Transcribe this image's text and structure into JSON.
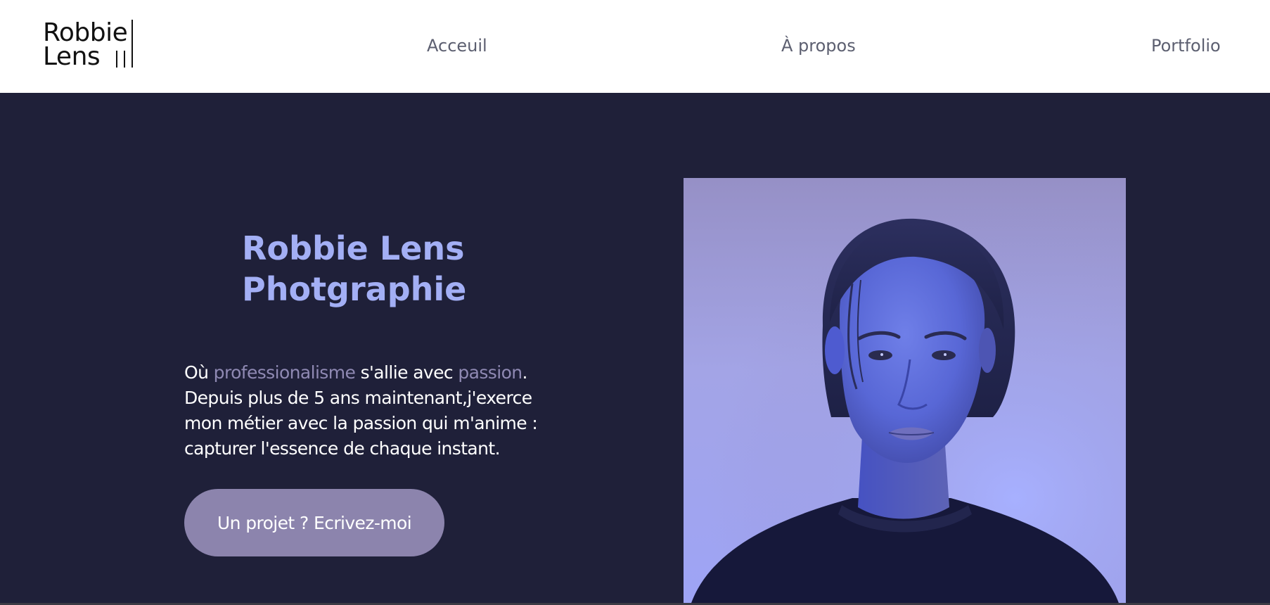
{
  "brand": {
    "logo_line1": "Robbie",
    "logo_line2": "Lens"
  },
  "nav": {
    "items": [
      {
        "label": "Acceuil"
      },
      {
        "label": "À propos"
      },
      {
        "label": "Portfolio"
      }
    ]
  },
  "hero": {
    "title_line1": "Robbie Lens",
    "title_line2": "Photgraphie",
    "desc": {
      "part1": "Où ",
      "highlight1": "professionalisme",
      "part2": " s'allie avec ",
      "highlight2": "passion",
      "part3": ". Depuis plus de 5 ans maintenant,j'exerce mon métier avec la passion qui m'anime : capturer l'essence de chaque instant."
    },
    "cta_label": "Un projet ? Ecrivez-moi",
    "photo_alt": "portrait-photo"
  },
  "colors": {
    "page_background": "#1f2039",
    "header_background": "#ffffff",
    "title": "#a3aff5",
    "highlight": "#8f89b3",
    "button": "#8c84ad",
    "nav_text": "#5c5f70"
  }
}
